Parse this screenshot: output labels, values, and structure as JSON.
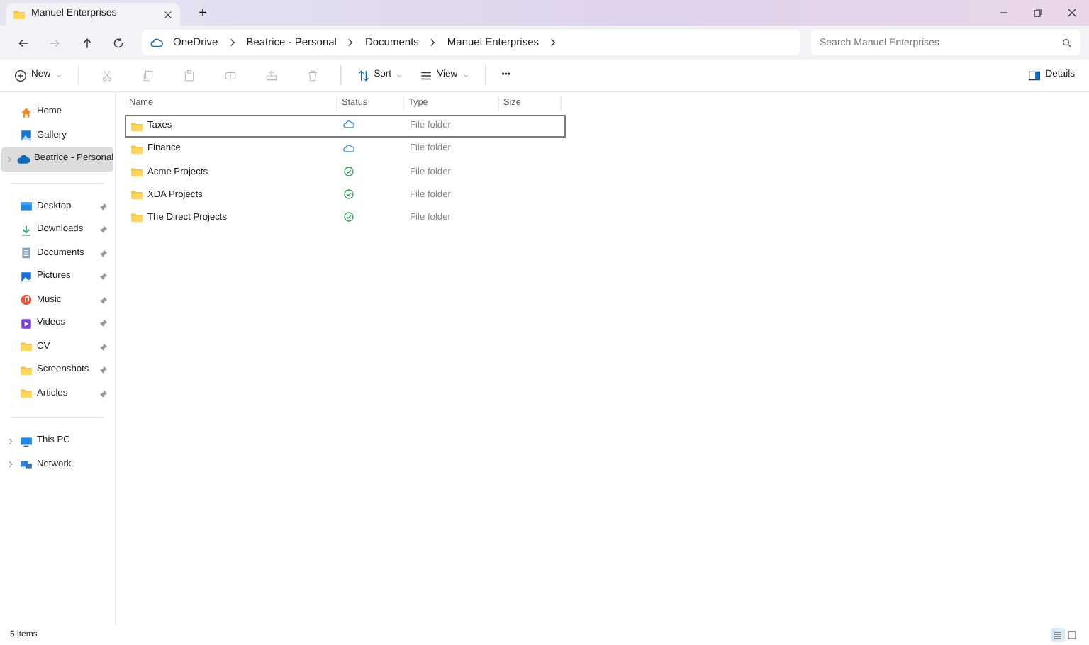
{
  "window": {
    "tab_title": "Manuel Enterprises",
    "new_tab": "+"
  },
  "address_bar": {
    "crumbs": [
      "OneDrive",
      "Beatrice - Personal",
      "Documents",
      "Manuel Enterprises"
    ]
  },
  "search": {
    "placeholder": "Search Manuel Enterprises"
  },
  "toolbar": {
    "new": "New",
    "sort": "Sort",
    "view": "View",
    "more": "•••",
    "details": "Details"
  },
  "sidebar": {
    "sections": [
      {
        "items": [
          {
            "label": "Home",
            "selected": false,
            "expandable": false,
            "pinned": false
          },
          {
            "label": "Gallery",
            "selected": false,
            "expandable": false,
            "pinned": false
          },
          {
            "label": "Beatrice - Personal",
            "selected": true,
            "expandable": true,
            "pinned": false
          }
        ]
      },
      {
        "items": [
          {
            "label": "Desktop",
            "selected": false,
            "expandable": false,
            "pinned": true
          },
          {
            "label": "Downloads",
            "selected": false,
            "expandable": false,
            "pinned": true
          },
          {
            "label": "Documents",
            "selected": false,
            "expandable": false,
            "pinned": true
          },
          {
            "label": "Pictures",
            "selected": false,
            "expandable": false,
            "pinned": true
          },
          {
            "label": "Music",
            "selected": false,
            "expandable": false,
            "pinned": true
          },
          {
            "label": "Videos",
            "selected": false,
            "expandable": false,
            "pinned": true
          },
          {
            "label": "CV",
            "selected": false,
            "expandable": false,
            "pinned": true
          },
          {
            "label": "Screenshots",
            "selected": false,
            "expandable": false,
            "pinned": true
          },
          {
            "label": "Articles",
            "selected": false,
            "expandable": false,
            "pinned": true
          }
        ]
      },
      {
        "items": [
          {
            "label": "This PC",
            "selected": false,
            "expandable": true,
            "pinned": false
          },
          {
            "label": "Network",
            "selected": false,
            "expandable": true,
            "pinned": false
          }
        ]
      }
    ]
  },
  "table": {
    "columns": [
      "Name",
      "Status",
      "Type",
      "Size"
    ],
    "rows": [
      {
        "name": "Taxes",
        "synced": false,
        "type": "File folder",
        "selected": true
      },
      {
        "name": "Finance",
        "synced": false,
        "type": "File folder",
        "selected": false
      },
      {
        "name": "Acme Projects",
        "synced": true,
        "type": "File folder",
        "selected": false
      },
      {
        "name": "XDA Projects",
        "synced": true,
        "type": "File folder",
        "selected": false
      },
      {
        "name": "The Direct Projects",
        "synced": true,
        "type": "File folder",
        "selected": false
      }
    ]
  },
  "status_bar": {
    "count": "5 items",
    "view_buttons": [
      {
        "selected": true
      },
      {
        "selected": false
      }
    ]
  }
}
